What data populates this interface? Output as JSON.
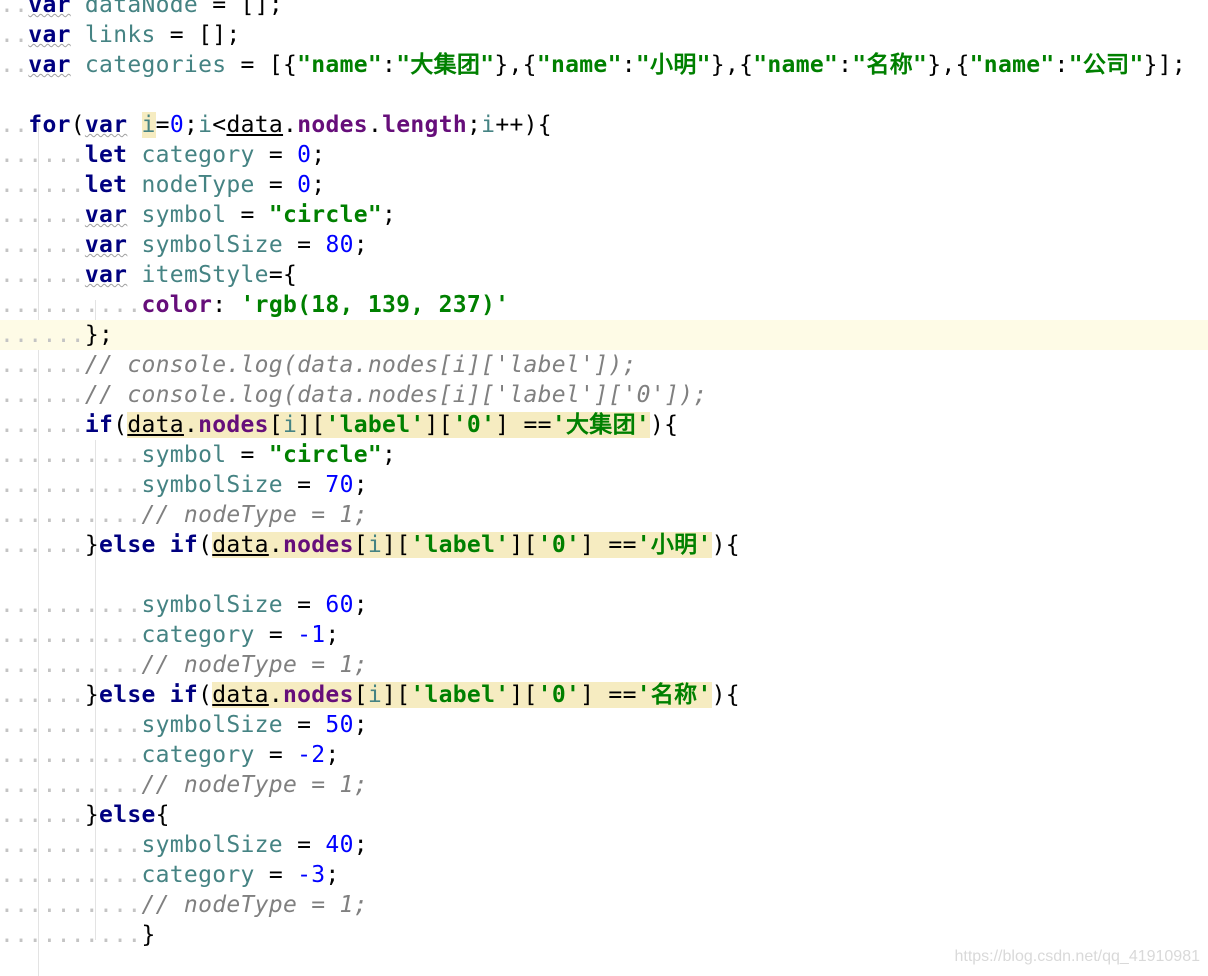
{
  "code_lines": [
    {
      "dots": "..",
      "parts": [
        [
          "kw",
          "var"
        ],
        [
          "pun",
          " "
        ],
        [
          "var",
          "dataNode"
        ],
        [
          "pun",
          " = [];"
        ]
      ]
    },
    {
      "dots": "..",
      "parts": [
        [
          "kw",
          "var"
        ],
        [
          "pun",
          " "
        ],
        [
          "var",
          "links"
        ],
        [
          "pun",
          " = [];"
        ]
      ]
    },
    {
      "dots": "..",
      "parts": [
        [
          "kw",
          "var"
        ],
        [
          "pun",
          " "
        ],
        [
          "var",
          "categories"
        ],
        [
          "pun",
          " = [{"
        ],
        [
          "str",
          "\"name\""
        ],
        [
          "pun",
          ":"
        ],
        [
          "str",
          "\"大集团\""
        ],
        [
          "pun",
          "},{"
        ],
        [
          "str",
          "\"name\""
        ],
        [
          "pun",
          ":"
        ],
        [
          "str",
          "\"小明\""
        ],
        [
          "pun",
          "},{"
        ],
        [
          "str",
          "\"name\""
        ],
        [
          "pun",
          ":"
        ],
        [
          "str",
          "\"名称\""
        ],
        [
          "pun",
          "},{"
        ],
        [
          "str",
          "\"name\""
        ],
        [
          "pun",
          ":"
        ],
        [
          "str",
          "\"公司\""
        ],
        [
          "pun",
          "}];"
        ]
      ]
    },
    {
      "dots": "",
      "parts": []
    },
    {
      "dots": "..",
      "parts": [
        [
          "kw",
          "for"
        ],
        [
          "pun",
          "("
        ],
        [
          "kw",
          "var"
        ],
        [
          "pun",
          " "
        ],
        [
          "hlvar",
          "i"
        ],
        [
          "pun",
          "="
        ],
        [
          "num",
          "0"
        ],
        [
          "pun",
          ";"
        ],
        [
          "var",
          "i"
        ],
        [
          "pun",
          "<"
        ],
        [
          "und",
          "data"
        ],
        [
          "pun",
          "."
        ],
        [
          "prop",
          "nodes"
        ],
        [
          "pun",
          "."
        ],
        [
          "prop",
          "length"
        ],
        [
          "pun",
          ";"
        ],
        [
          "var",
          "i"
        ],
        [
          "pun",
          "++){"
        ]
      ]
    },
    {
      "dots": "......",
      "parts": [
        [
          "kw",
          "let"
        ],
        [
          "pun",
          " "
        ],
        [
          "var",
          "category"
        ],
        [
          "pun",
          " = "
        ],
        [
          "num",
          "0"
        ],
        [
          "pun",
          ";"
        ]
      ]
    },
    {
      "dots": "......",
      "parts": [
        [
          "kw",
          "let"
        ],
        [
          "pun",
          " "
        ],
        [
          "var",
          "nodeType"
        ],
        [
          "pun",
          " = "
        ],
        [
          "num",
          "0"
        ],
        [
          "pun",
          ";"
        ]
      ]
    },
    {
      "dots": "......",
      "parts": [
        [
          "kw",
          "var"
        ],
        [
          "pun",
          " "
        ],
        [
          "var",
          "symbol"
        ],
        [
          "pun",
          " = "
        ],
        [
          "str",
          "\"circle\""
        ],
        [
          "pun",
          ";"
        ]
      ]
    },
    {
      "dots": "......",
      "parts": [
        [
          "kw",
          "var"
        ],
        [
          "pun",
          " "
        ],
        [
          "var",
          "symbolSize"
        ],
        [
          "pun",
          " = "
        ],
        [
          "num",
          "80"
        ],
        [
          "pun",
          ";"
        ]
      ]
    },
    {
      "dots": "......",
      "parts": [
        [
          "kw",
          "var"
        ],
        [
          "pun",
          " "
        ],
        [
          "var",
          "itemStyle"
        ],
        [
          "pun",
          "={"
        ]
      ]
    },
    {
      "dots": "..........",
      "parts": [
        [
          "prop",
          "color"
        ],
        [
          "pun",
          ": "
        ],
        [
          "str",
          "'rgb(18, 139, 237)'"
        ]
      ]
    },
    {
      "dots": "......",
      "current": true,
      "parts": [
        [
          "pun",
          "};"
        ]
      ]
    },
    {
      "dots": "......",
      "parts": [
        [
          "cmt",
          "// console.log(data.nodes[i]['label']);"
        ]
      ]
    },
    {
      "dots": "......",
      "parts": [
        [
          "cmt",
          "// console.log(data.nodes[i]['label']['0']);"
        ]
      ]
    },
    {
      "dots": "......",
      "parts": [
        [
          "kw",
          "if"
        ],
        [
          "pun",
          "("
        ],
        [
          "hlund",
          "data"
        ],
        [
          "hlpun",
          "."
        ],
        [
          "hlprop",
          "nodes"
        ],
        [
          "hlpun",
          "["
        ],
        [
          "hlvar",
          "i"
        ],
        [
          "hlpun",
          "]["
        ],
        [
          "hlstr",
          "'label'"
        ],
        [
          "hlpun",
          "]["
        ],
        [
          "hlstr",
          "'0'"
        ],
        [
          "hlpun",
          "] =="
        ],
        [
          "hlstr",
          "'大集团'"
        ],
        [
          "pun",
          "){"
        ]
      ]
    },
    {
      "dots": "..........",
      "parts": [
        [
          "var",
          "symbol"
        ],
        [
          "pun",
          " = "
        ],
        [
          "str",
          "\"circle\""
        ],
        [
          "pun",
          ";"
        ]
      ]
    },
    {
      "dots": "..........",
      "parts": [
        [
          "var",
          "symbolSize"
        ],
        [
          "pun",
          " = "
        ],
        [
          "num",
          "70"
        ],
        [
          "pun",
          ";"
        ]
      ]
    },
    {
      "dots": "..........",
      "parts": [
        [
          "cmt",
          "// nodeType = 1;"
        ]
      ]
    },
    {
      "dots": "......",
      "parts": [
        [
          "pun",
          "}"
        ],
        [
          "kw",
          "else if"
        ],
        [
          "pun",
          "("
        ],
        [
          "hlund",
          "data"
        ],
        [
          "hlpun",
          "."
        ],
        [
          "hlprop",
          "nodes"
        ],
        [
          "hlpun",
          "["
        ],
        [
          "hlvar",
          "i"
        ],
        [
          "hlpun",
          "]["
        ],
        [
          "hlstr",
          "'label'"
        ],
        [
          "hlpun",
          "]["
        ],
        [
          "hlstr",
          "'0'"
        ],
        [
          "hlpun",
          "] =="
        ],
        [
          "hlstr",
          "'小明'"
        ],
        [
          "pun",
          "){"
        ]
      ]
    },
    {
      "dots": "",
      "parts": []
    },
    {
      "dots": "..........",
      "parts": [
        [
          "var",
          "symbolSize"
        ],
        [
          "pun",
          " = "
        ],
        [
          "num",
          "60"
        ],
        [
          "pun",
          ";"
        ]
      ]
    },
    {
      "dots": "..........",
      "parts": [
        [
          "var",
          "category"
        ],
        [
          "pun",
          " = "
        ],
        [
          "num",
          "-1"
        ],
        [
          "pun",
          ";"
        ]
      ]
    },
    {
      "dots": "..........",
      "parts": [
        [
          "cmt",
          "// nodeType = 1;"
        ]
      ]
    },
    {
      "dots": "......",
      "parts": [
        [
          "pun",
          "}"
        ],
        [
          "kw",
          "else if"
        ],
        [
          "pun",
          "("
        ],
        [
          "hlund",
          "data"
        ],
        [
          "hlpun",
          "."
        ],
        [
          "hlprop",
          "nodes"
        ],
        [
          "hlpun",
          "["
        ],
        [
          "hlvar",
          "i"
        ],
        [
          "hlpun",
          "]["
        ],
        [
          "hlstr",
          "'label'"
        ],
        [
          "hlpun",
          "]["
        ],
        [
          "hlstr",
          "'0'"
        ],
        [
          "hlpun",
          "] =="
        ],
        [
          "hlstr",
          "'名称'"
        ],
        [
          "pun",
          "){"
        ]
      ]
    },
    {
      "dots": "..........",
      "parts": [
        [
          "var",
          "symbolSize"
        ],
        [
          "pun",
          " = "
        ],
        [
          "num",
          "50"
        ],
        [
          "pun",
          ";"
        ]
      ]
    },
    {
      "dots": "..........",
      "parts": [
        [
          "var",
          "category"
        ],
        [
          "pun",
          " = "
        ],
        [
          "num",
          "-2"
        ],
        [
          "pun",
          ";"
        ]
      ]
    },
    {
      "dots": "..........",
      "parts": [
        [
          "cmt",
          "// nodeType = 1;"
        ]
      ]
    },
    {
      "dots": "......",
      "parts": [
        [
          "pun",
          "}"
        ],
        [
          "kw",
          "else"
        ],
        [
          "pun",
          "{"
        ]
      ]
    },
    {
      "dots": "..........",
      "parts": [
        [
          "var",
          "symbolSize"
        ],
        [
          "pun",
          " = "
        ],
        [
          "num",
          "40"
        ],
        [
          "pun",
          ";"
        ]
      ]
    },
    {
      "dots": "..........",
      "parts": [
        [
          "var",
          "category"
        ],
        [
          "pun",
          " = "
        ],
        [
          "num",
          "-3"
        ],
        [
          "pun",
          ";"
        ]
      ]
    },
    {
      "dots": "..........",
      "parts": [
        [
          "cmt",
          "// nodeType = 1;"
        ]
      ]
    },
    {
      "dots": "..........",
      "parts": [
        [
          "pun",
          "}"
        ]
      ]
    }
  ],
  "watermark": "https://blog.csdn.net/qq_41910981",
  "colors": {
    "keyword": "#000080",
    "identifier": "#458383",
    "string": "#008000",
    "number": "#0000ff",
    "property": "#660e7a",
    "comment": "#808080",
    "current_line": "#fefbe6",
    "usage_highlight": "#f6ecc1"
  }
}
